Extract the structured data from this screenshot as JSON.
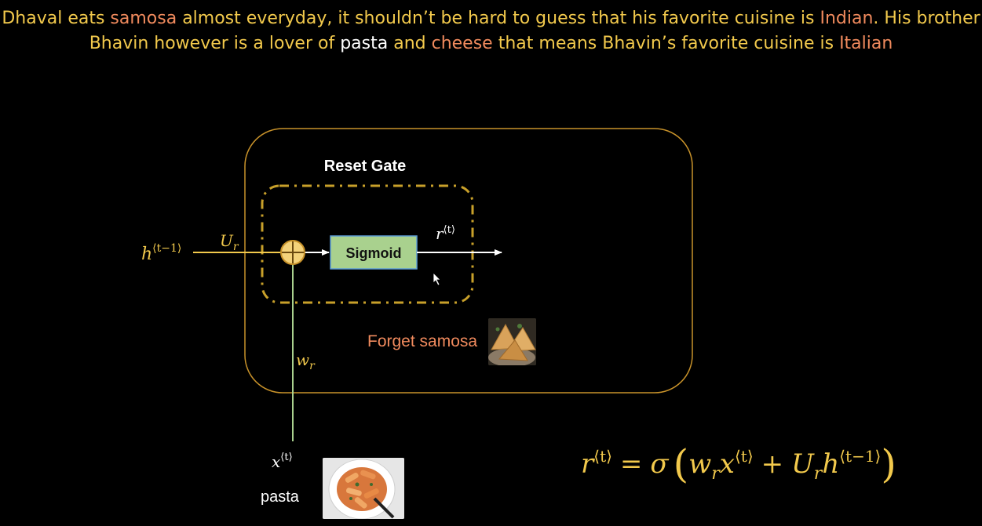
{
  "header": {
    "line1": [
      {
        "text": "Dhaval eats ",
        "c": "y"
      },
      {
        "text": "samosa",
        "c": "o"
      },
      {
        "text": " almost everyday, it shouldn’t be hard to guess that his favorite cuisine is ",
        "c": "y"
      },
      {
        "text": "Indian",
        "c": "o"
      },
      {
        "text": ". His brother",
        "c": "y"
      }
    ],
    "line2": [
      {
        "text": "Bhavin however is a lover of ",
        "c": "y"
      },
      {
        "text": "pasta",
        "c": "w"
      },
      {
        "text": " and ",
        "c": "y"
      },
      {
        "text": "cheese",
        "c": "o"
      },
      {
        "text": " that means Bhavin’s favorite cuisine is ",
        "c": "y"
      },
      {
        "text": "Italian",
        "c": "o"
      }
    ]
  },
  "diagram": {
    "gate_title": "Reset Gate",
    "sigmoid_label": "Sigmoid",
    "h_prev": {
      "base": "h",
      "sup": "⟨t−1⟩"
    },
    "u_weight": {
      "base": "U",
      "sub": "r"
    },
    "w_weight": {
      "base": "w",
      "sub": "r"
    },
    "x_input": {
      "base": "x",
      "sup": "⟨t⟩"
    },
    "r_output": {
      "base": "r",
      "sup": "⟨t⟩"
    },
    "forget_label": "Forget samosa",
    "pasta_label": "pasta",
    "samosa_icon": "samosa-photo",
    "pasta_icon": "pasta-photo"
  },
  "formula": {
    "lhs": {
      "base": "r",
      "sup": "⟨t⟩"
    },
    "eq": "=",
    "sigma": "σ",
    "term1": {
      "w": "w",
      "wsub": "r",
      "x": "x",
      "xsup": "⟨t⟩"
    },
    "plus": "+",
    "term2": {
      "u": "U",
      "usub": "r",
      "h": "h",
      "hsup": "⟨t−1⟩"
    }
  },
  "colors": {
    "yellow": "#f2c94c",
    "orange": "#f08a5d",
    "box_border": "#c8922a",
    "dash_border": "#c8a02a",
    "sigmoid_fill": "#a9d18e",
    "sigmoid_stroke": "#5b9bd5",
    "line_green": "#a9d18e"
  }
}
